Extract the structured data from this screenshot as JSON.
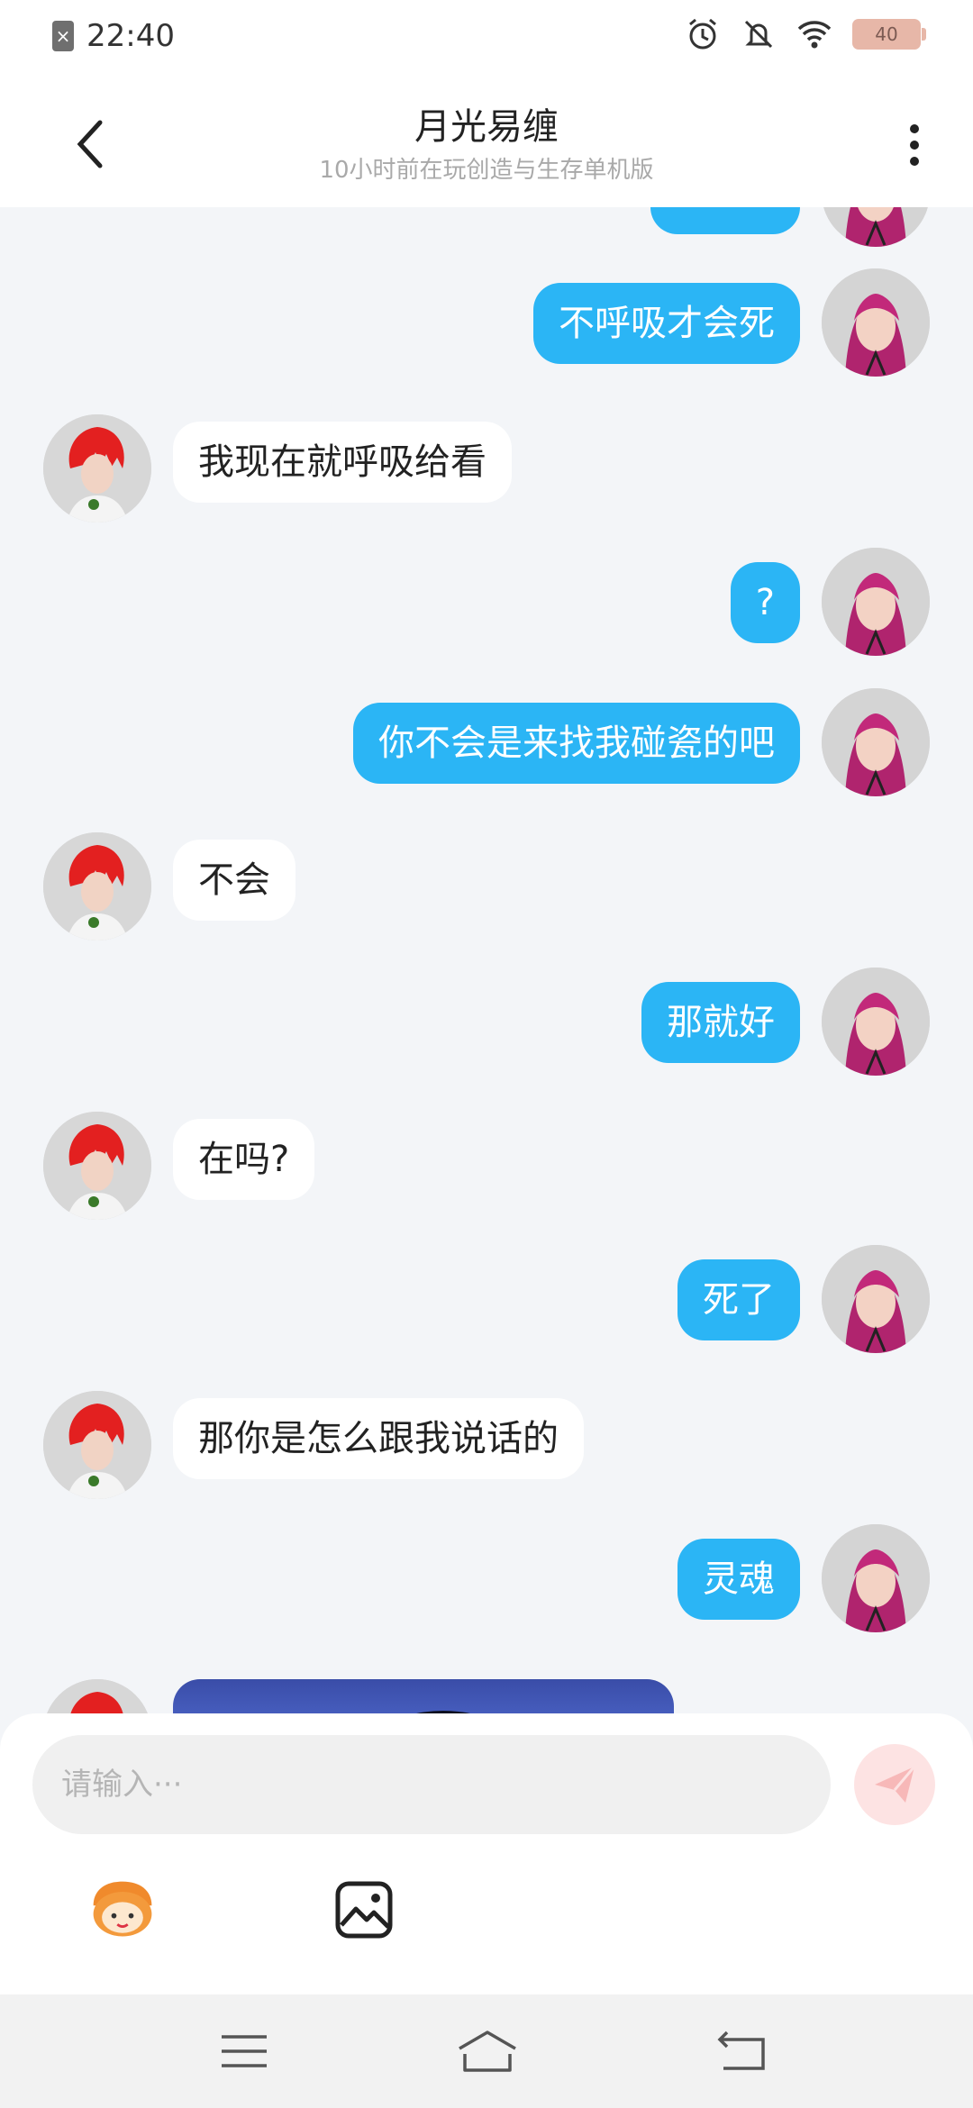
{
  "status_bar": {
    "time": "22:40",
    "battery": "40",
    "icons": [
      "sim-x-icon",
      "alarm-icon",
      "mute-icon",
      "wifi-icon",
      "battery-icon"
    ]
  },
  "header": {
    "title": "月光易缠",
    "subtitle": "10小时前在玩创造与生存单机版",
    "back_icon": "chevron-left-icon",
    "more_icon": "more-vertical-icon"
  },
  "messages": [
    {
      "sender": "me",
      "text": ""
    },
    {
      "sender": "me",
      "text": "不呼吸才会死"
    },
    {
      "sender": "other",
      "text": "我现在就呼吸给看"
    },
    {
      "sender": "me",
      "text": "?"
    },
    {
      "sender": "me",
      "text": "你不会是来找我碰瓷的吧"
    },
    {
      "sender": "other",
      "text": "不会"
    },
    {
      "sender": "me",
      "text": "那就好"
    },
    {
      "sender": "other",
      "text": "在吗?"
    },
    {
      "sender": "me",
      "text": "死了"
    },
    {
      "sender": "other",
      "text": "那你是怎么跟我说话的"
    },
    {
      "sender": "me",
      "text": "灵魂"
    },
    {
      "sender": "other",
      "type": "image",
      "text": ""
    }
  ],
  "input": {
    "placeholder": "请输入···",
    "value": "",
    "send_icon": "send-icon"
  },
  "tools": [
    "emoji-mascot-icon",
    "image-picker-icon"
  ],
  "nav": [
    "menu-icon",
    "home-icon",
    "back-icon"
  ],
  "colors": {
    "my_bubble": "#2bb5f5",
    "other_bubble": "#ffffff",
    "chat_background": "#f3f5f8",
    "send_button": "#fde3e3"
  }
}
